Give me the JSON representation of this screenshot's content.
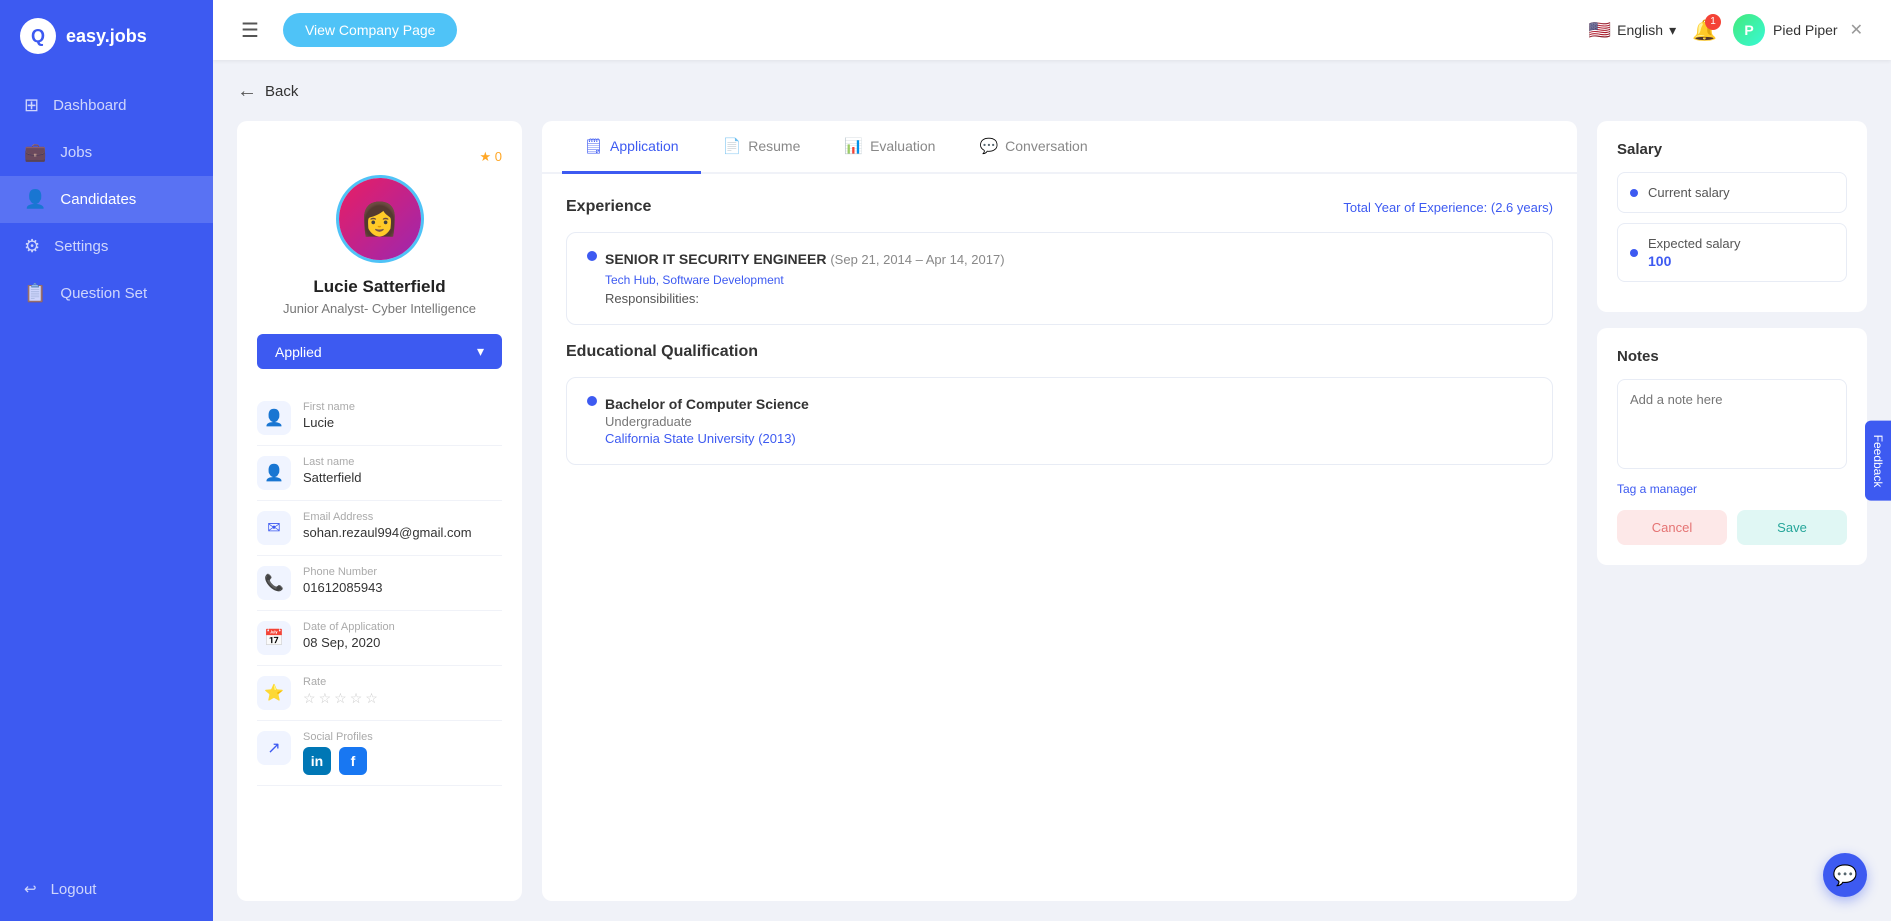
{
  "app": {
    "logo_letter": "Q",
    "logo_name": "easy.jobs"
  },
  "sidebar": {
    "items": [
      {
        "id": "dashboard",
        "label": "Dashboard",
        "icon": "⊞"
      },
      {
        "id": "jobs",
        "label": "Jobs",
        "icon": "💼"
      },
      {
        "id": "candidates",
        "label": "Candidates",
        "icon": "👤",
        "active": true
      },
      {
        "id": "settings",
        "label": "Settings",
        "icon": "⚙"
      },
      {
        "id": "question-set",
        "label": "Question Set",
        "icon": "📋"
      }
    ],
    "logout": {
      "label": "Logout",
      "icon": "↩"
    }
  },
  "topbar": {
    "menu_icon": "☰",
    "view_company_btn": "View Company Page",
    "language": "English",
    "notification_count": "1",
    "company_name": "Pied Piper",
    "company_initial": "P"
  },
  "back_btn": "Back",
  "candidate": {
    "name": "Lucie Satterfield",
    "title": "Junior Analyst- Cyber Intelligence",
    "status": "Applied",
    "star_count": "★ 0",
    "avatar_letter": "👩",
    "fields": [
      {
        "id": "first-name",
        "label": "First name",
        "value": "Lucie",
        "icon": "👤"
      },
      {
        "id": "last-name",
        "label": "Last name",
        "value": "Satterfield",
        "icon": "👤"
      },
      {
        "id": "email",
        "label": "Email Address",
        "value": "sohan.rezaul994@gmail.com",
        "icon": "✉"
      },
      {
        "id": "phone",
        "label": "Phone Number",
        "value": "01612085943",
        "icon": "📞"
      },
      {
        "id": "date",
        "label": "Date of Application",
        "value": "08 Sep, 2020",
        "icon": "📅"
      },
      {
        "id": "rate",
        "label": "Rate",
        "value": "",
        "icon": "⭐"
      },
      {
        "id": "social",
        "label": "Social Profiles",
        "value": "",
        "icon": "↗"
      }
    ]
  },
  "tabs": [
    {
      "id": "application",
      "label": "Application",
      "icon": "🗒",
      "active": true
    },
    {
      "id": "resume",
      "label": "Resume",
      "icon": "📄"
    },
    {
      "id": "evaluation",
      "label": "Evaluation",
      "icon": "📊"
    },
    {
      "id": "conversation",
      "label": "Conversation",
      "icon": "💬"
    }
  ],
  "experience": {
    "section_title": "Experience",
    "total_years_label": "Total Year of Experience:",
    "total_years_value": "(2.6 years)",
    "items": [
      {
        "title": "SENIOR IT SECURITY ENGINEER",
        "dates": "(Sep 21, 2014 – Apr 14, 2017)",
        "tags": "Tech Hub, Software Development",
        "responsibilities_label": "Responsibilities:"
      }
    ]
  },
  "education": {
    "section_title": "Educational Qualification",
    "items": [
      {
        "degree": "Bachelor of Computer Science",
        "level": "Undergraduate",
        "university": "California State University",
        "year": "(2013)"
      }
    ]
  },
  "salary": {
    "section_title": "Salary",
    "current_salary_label": "Current salary",
    "expected_salary_label": "Expected salary",
    "expected_salary_value": "100"
  },
  "notes": {
    "section_title": "Notes",
    "placeholder": "Add a note here",
    "tag_manager": "Tag a manager",
    "cancel_btn": "Cancel",
    "save_btn": "Save"
  },
  "side_tab": "Feedback",
  "float_chat": "💬"
}
